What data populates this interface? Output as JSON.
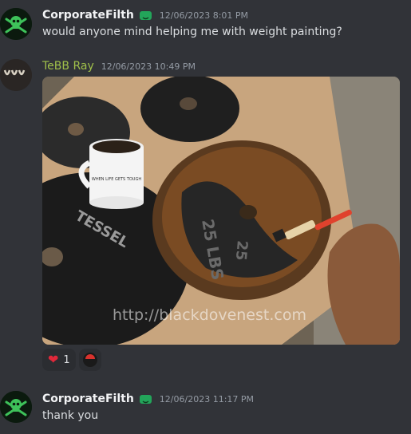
{
  "messages": [
    {
      "author": "CorporateFilth",
      "timestamp": "12/06/2023 8:01 PM",
      "text": "would anyone mind helping me with weight painting?"
    },
    {
      "author": "TeBB Ray",
      "timestamp": "12/06/2023 10:49 PM",
      "image": {
        "mug_text": "WHEN LIFE GETS TOUGH",
        "plate_labels": [
          "25 LBS",
          "25",
          "TESSEL"
        ],
        "watermark": "http://blackdovenest.com"
      },
      "reactions": [
        {
          "emoji": "heart-icon",
          "count": "1"
        },
        {
          "emoji": "sticker-face-icon",
          "count": ""
        }
      ]
    },
    {
      "author": "CorporateFilth",
      "timestamp": "12/06/2023 11:17 PM",
      "text": "thank you"
    }
  ],
  "colors": {
    "background": "#313338",
    "author_green": "#a0c04a",
    "badge_green": "#23a55a",
    "heart": "#e0283a"
  }
}
